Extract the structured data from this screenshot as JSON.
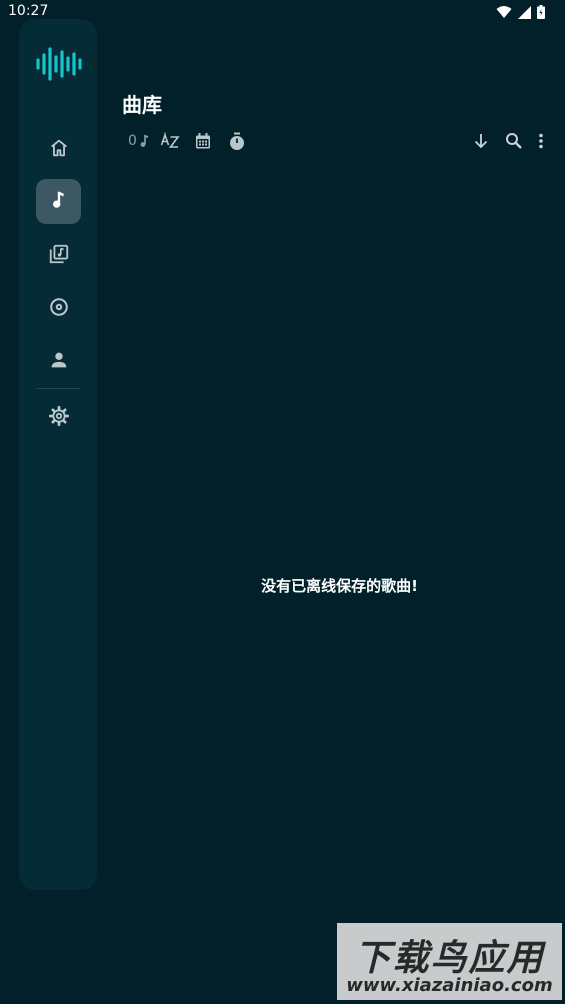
{
  "status_bar": {
    "time": "10:27"
  },
  "sidebar": {
    "items": [
      {
        "name": "home",
        "icon": "home-icon",
        "active": false
      },
      {
        "name": "songs",
        "icon": "music-note-icon",
        "active": true
      },
      {
        "name": "playlists",
        "icon": "playlist-icon",
        "active": false
      },
      {
        "name": "albums",
        "icon": "disc-icon",
        "active": false
      },
      {
        "name": "artists",
        "icon": "person-icon",
        "active": false
      },
      {
        "name": "settings",
        "icon": "gear-icon",
        "active": false
      }
    ]
  },
  "header": {
    "title": "曲库"
  },
  "toolbar": {
    "song_count": "0",
    "left_icons": [
      "music-note-icon",
      "sort-az-icon",
      "calendar-icon",
      "timer-icon"
    ],
    "right_icons": [
      "download-icon",
      "search-icon",
      "more-vert-icon"
    ]
  },
  "main": {
    "empty_message": "没有已离线保存的歌曲!"
  },
  "watermark": {
    "title": "下载鸟应用",
    "url": "www.xiazainiao.com"
  },
  "colors": {
    "background": "#02202a",
    "rail": "#052b36",
    "active": "#3b5863",
    "accent": "#19c3c9"
  }
}
